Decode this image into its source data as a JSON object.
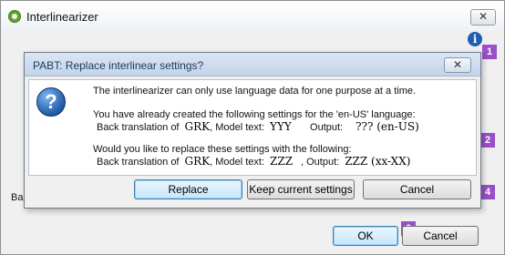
{
  "window": {
    "title": "Interlinearizer",
    "close_glyph": "✕",
    "info_glyph": "i",
    "left_label_partial": "Ba",
    "ok_label": "OK",
    "cancel_label": "Cancel"
  },
  "badges": {
    "b1": "1",
    "b2": "2",
    "b4": "4",
    "b6": "6"
  },
  "dialog": {
    "title": "PABT: Replace interlinear settings?",
    "close_glyph": "✕",
    "question_glyph": "?",
    "intro": "The interlinearizer can only use language data for one purpose at a time.",
    "current_intro": "You have already created the following settings for the 'en-US' language:",
    "current": {
      "back_translation_label": "Back translation of",
      "back_translation_value": "GRK",
      "model_text_label": ", Model text:",
      "model_text_value": "YYY",
      "output_label": "Output:",
      "output_value": "??? (en-US)"
    },
    "replace_intro": "Would you like to replace these settings with the following:",
    "new": {
      "back_translation_label": "Back translation of",
      "back_translation_value": "GRK",
      "model_text_label": ", Model text:",
      "model_text_value": "ZZZ",
      "output_label": ", Output:",
      "output_value": "ZZZ (xx-XX)"
    },
    "buttons": {
      "replace": "Replace",
      "keep": "Keep current settings",
      "cancel": "Cancel"
    }
  }
}
